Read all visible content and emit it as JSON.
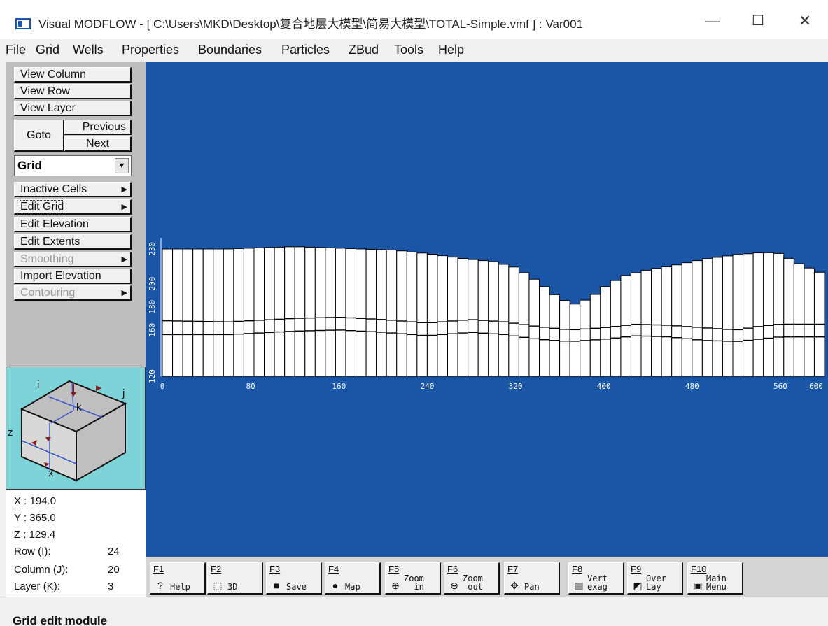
{
  "window": {
    "title": "Visual MODFLOW - [ C:\\Users\\MKD\\Desktop\\复合地层大模型\\简易大模型\\TOTAL-Simple.vmf ] : Var001",
    "minimize": "—",
    "maximize": "☐",
    "close": "✕"
  },
  "menu": [
    "File",
    "Grid",
    "Wells",
    "Properties",
    "Boundaries",
    "Particles",
    "ZBud",
    "Tools",
    "Help"
  ],
  "left_panel": {
    "view_column": "View Column",
    "view_row": "View Row",
    "view_layer": "View Layer",
    "goto": "Goto",
    "previous": "Previous",
    "next": "Next",
    "mode_select": "Grid",
    "items": [
      {
        "label": "Inactive Cells",
        "submenu": true,
        "enabled": true
      },
      {
        "label": "Edit Grid",
        "submenu": true,
        "enabled": true
      },
      {
        "label": "Edit Elevation",
        "submenu": false,
        "enabled": true
      },
      {
        "label": "Edit Extents",
        "submenu": false,
        "enabled": true
      },
      {
        "label": "Smoothing",
        "submenu": true,
        "enabled": false
      },
      {
        "label": "Import Elevation",
        "submenu": false,
        "enabled": true
      },
      {
        "label": "Contouring",
        "submenu": true,
        "enabled": false
      }
    ]
  },
  "orientation": {
    "i": "i",
    "j": "j",
    "k": "k",
    "x": "x",
    "z": "z"
  },
  "coords": {
    "x": "X : 194.0",
    "y": "Y : 365.0",
    "z": "Z : 129.4",
    "row_label": "Row   (I):",
    "row_val": "24",
    "col_label": "Column (J):",
    "col_val": "20",
    "layer_label": "Layer  (K):",
    "layer_val": "3"
  },
  "chart_data": {
    "type": "area",
    "description_free": true,
    "x_ticks": [
      "0",
      "80",
      "160",
      "240",
      "320",
      "400",
      "480",
      "560",
      "600"
    ],
    "x_tick_values": [
      0,
      80,
      160,
      240,
      320,
      400,
      480,
      560,
      600
    ],
    "y_ticks": [
      "120",
      "160",
      "180",
      "200",
      "230"
    ],
    "y_tick_values": [
      120,
      160,
      180,
      200,
      230
    ],
    "xlim": [
      0,
      600
    ],
    "ylim": [
      120,
      236
    ],
    "top_surface": [
      [
        0,
        230
      ],
      [
        30,
        230
      ],
      [
        60,
        230
      ],
      [
        90,
        231
      ],
      [
        120,
        232
      ],
      [
        150,
        231
      ],
      [
        180,
        230
      ],
      [
        210,
        229
      ],
      [
        240,
        226
      ],
      [
        270,
        222
      ],
      [
        300,
        219
      ],
      [
        320,
        214
      ],
      [
        340,
        202
      ],
      [
        360,
        187
      ],
      [
        375,
        182
      ],
      [
        390,
        189
      ],
      [
        405,
        200
      ],
      [
        420,
        207
      ],
      [
        440,
        212
      ],
      [
        460,
        215
      ],
      [
        490,
        221
      ],
      [
        520,
        225
      ],
      [
        545,
        227
      ],
      [
        560,
        226
      ],
      [
        575,
        218
      ],
      [
        590,
        212
      ],
      [
        600,
        208
      ]
    ],
    "layer1_bottom": [
      [
        0,
        168
      ],
      [
        60,
        167
      ],
      [
        120,
        170
      ],
      [
        160,
        171
      ],
      [
        200,
        169
      ],
      [
        240,
        166
      ],
      [
        280,
        169
      ],
      [
        310,
        167
      ],
      [
        340,
        163
      ],
      [
        370,
        160
      ],
      [
        400,
        162
      ],
      [
        430,
        165
      ],
      [
        460,
        164
      ],
      [
        490,
        162
      ],
      [
        520,
        160
      ],
      [
        540,
        163
      ],
      [
        560,
        165
      ],
      [
        600,
        165
      ]
    ],
    "layer2_bottom": [
      [
        0,
        156
      ],
      [
        60,
        156
      ],
      [
        120,
        159
      ],
      [
        160,
        160
      ],
      [
        200,
        158
      ],
      [
        240,
        155
      ],
      [
        280,
        158
      ],
      [
        310,
        156
      ],
      [
        340,
        152
      ],
      [
        370,
        150
      ],
      [
        400,
        152
      ],
      [
        430,
        155
      ],
      [
        460,
        154
      ],
      [
        490,
        151
      ],
      [
        520,
        150
      ],
      [
        540,
        152
      ],
      [
        560,
        154
      ],
      [
        600,
        154
      ]
    ],
    "bottom": 120,
    "columns": 65
  },
  "fkeys": [
    {
      "num": "F1",
      "label": "Help",
      "icon": "help-icon",
      "glyph": "?"
    },
    {
      "num": "F2",
      "label": "3D",
      "icon": "3d-icon",
      "glyph": "⬚"
    },
    {
      "num": "F3",
      "label": "Save",
      "icon": "save-icon",
      "glyph": "■"
    },
    {
      "num": "F4",
      "label": "Map",
      "icon": "globe-icon",
      "glyph": "●"
    },
    {
      "num": "F5",
      "label": "Zoom\n  in",
      "icon": "zoom-in-icon",
      "glyph": "⊕"
    },
    {
      "num": "F6",
      "label": "Zoom\n out",
      "icon": "zoom-out-icon",
      "glyph": "⊖"
    },
    {
      "num": "F7",
      "label": "Pan",
      "icon": "pan-icon",
      "glyph": "✥"
    },
    {
      "num": "F8",
      "label": "Vert\nexag",
      "icon": "vert-exag-icon",
      "glyph": "▥"
    },
    {
      "num": "F9",
      "label": "Over\nLay",
      "icon": "overlay-icon",
      "glyph": "◩"
    },
    {
      "num": "F10",
      "label": "Main\nMenu",
      "icon": "main-menu-icon",
      "glyph": "▣"
    }
  ],
  "status": "Grid edit module",
  "colors": {
    "view_bg": "#1b55a6",
    "orient_bg": "#7ed3d8",
    "axis": "#ffffff"
  }
}
